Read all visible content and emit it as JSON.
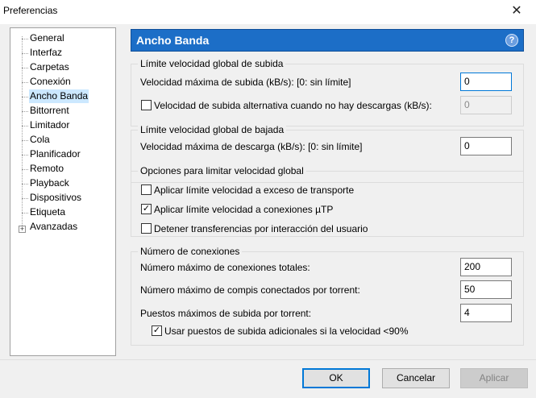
{
  "window": {
    "title": "Preferencias",
    "close_glyph": "✕"
  },
  "sidebar": {
    "items": [
      {
        "label": "General"
      },
      {
        "label": "Interfaz"
      },
      {
        "label": "Carpetas"
      },
      {
        "label": "Conexión"
      },
      {
        "label": "Ancho Banda",
        "selected": true
      },
      {
        "label": "Bittorrent"
      },
      {
        "label": "Limitador"
      },
      {
        "label": "Cola"
      },
      {
        "label": "Planificador"
      },
      {
        "label": "Remoto"
      },
      {
        "label": "Playback"
      },
      {
        "label": "Dispositivos"
      },
      {
        "label": "Etiqueta"
      },
      {
        "label": "Avanzadas",
        "expandable": true
      }
    ],
    "expander_glyph": "+"
  },
  "header": {
    "title": "Ancho Banda",
    "help_glyph": "?"
  },
  "upload": {
    "group_title": "Límite velocidad global de subida",
    "max_label": "Velocidad máxima de subida (kB/s): [0: sin límite]",
    "max_value": "0",
    "alt_label": "Velocidad de subida alternativa cuando no hay descargas (kB/s):",
    "alt_checked": false,
    "alt_value": "0"
  },
  "download": {
    "group_title": "Límite velocidad global de bajada",
    "max_label": "Velocidad máxima de descarga (kB/s): [0: sin límite]",
    "max_value": "0"
  },
  "options": {
    "group_title": "Opciones para limitar velocidad global",
    "transport_label": "Aplicar límite velocidad a exceso de transporte",
    "transport_checked": false,
    "utp_label": "Aplicar límite velocidad a conexiones µTP",
    "utp_checked": true,
    "stop_label": "Detener transferencias por interacción del usuario",
    "stop_checked": false
  },
  "connections": {
    "group_title": "Número de conexiones",
    "total_label": "Número máximo de conexiones totales:",
    "total_value": "200",
    "peers_label": "Número máximo de compis conectados por torrent:",
    "peers_value": "50",
    "slots_label": "Puestos máximos de subida por torrent:",
    "slots_value": "4",
    "extra_label": "Usar puestos de subida adicionales si la velocidad <90%",
    "extra_checked": true
  },
  "buttons": {
    "ok": "OK",
    "cancel": "Cancelar",
    "apply": "Aplicar"
  },
  "check_glyph": "✓",
  "colors": {
    "header_blue": "#1c6ec7",
    "selected_bg": "#cce8ff"
  }
}
